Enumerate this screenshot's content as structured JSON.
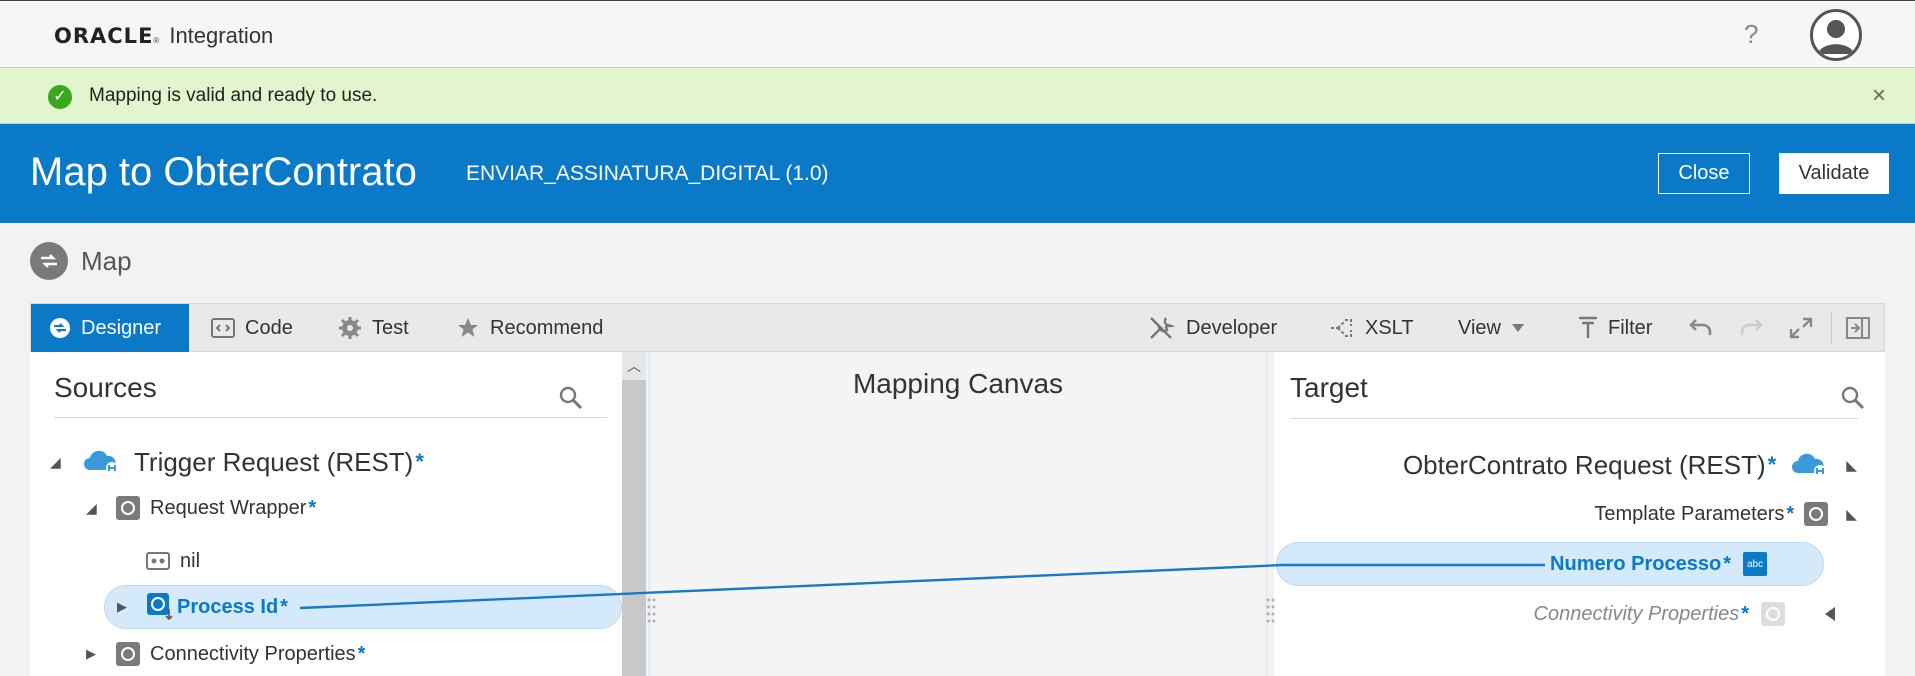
{
  "app": {
    "brand": "ORACLE",
    "product": "Integration",
    "help": "?"
  },
  "banner": {
    "message": "Mapping is valid and ready to use.",
    "close": "×"
  },
  "header": {
    "title": "Map to ObterContrato",
    "subtitle": "ENVIAR_ASSINATURA_DIGITAL (1.0)",
    "close_label": "Close",
    "validate_label": "Validate"
  },
  "section": {
    "label": "Map"
  },
  "toolbar": {
    "tabs": [
      {
        "label": "Designer",
        "icon": "designer-icon",
        "active": true
      },
      {
        "label": "Code",
        "icon": "code-icon"
      },
      {
        "label": "Test",
        "icon": "gear-icon"
      },
      {
        "label": "Recommend",
        "icon": "star-icon"
      }
    ],
    "right": [
      {
        "label": "Developer",
        "icon": "wrench-icon"
      },
      {
        "label": "XSLT",
        "icon": "xslt-icon"
      },
      {
        "label": "View",
        "icon": "chevron-down-icon"
      },
      {
        "label": "Filter",
        "icon": "filter-icon"
      }
    ]
  },
  "sources": {
    "title": "Sources",
    "nodes": [
      {
        "label": "Trigger Request (REST)",
        "required": "*"
      },
      {
        "label": "Request Wrapper",
        "required": "*"
      },
      {
        "label": "nil"
      },
      {
        "label": "Process Id",
        "required": "*"
      },
      {
        "label": "Connectivity Properties",
        "required": "*"
      }
    ]
  },
  "canvas": {
    "title": "Mapping Canvas"
  },
  "target": {
    "title": "Target",
    "nodes": [
      {
        "label": "ObterContrato Request (REST)",
        "required": "*"
      },
      {
        "label": "Template Parameters",
        "required": "*"
      },
      {
        "label": "Numero Processo",
        "required": "*",
        "type_badge": "abc"
      },
      {
        "label": "Connectivity Properties",
        "required": "*"
      }
    ]
  },
  "colors": {
    "accent": "#0a79c8",
    "success": "#39a820",
    "banner_bg": "#e3f5cf",
    "highlight": "#d4e9fa"
  }
}
